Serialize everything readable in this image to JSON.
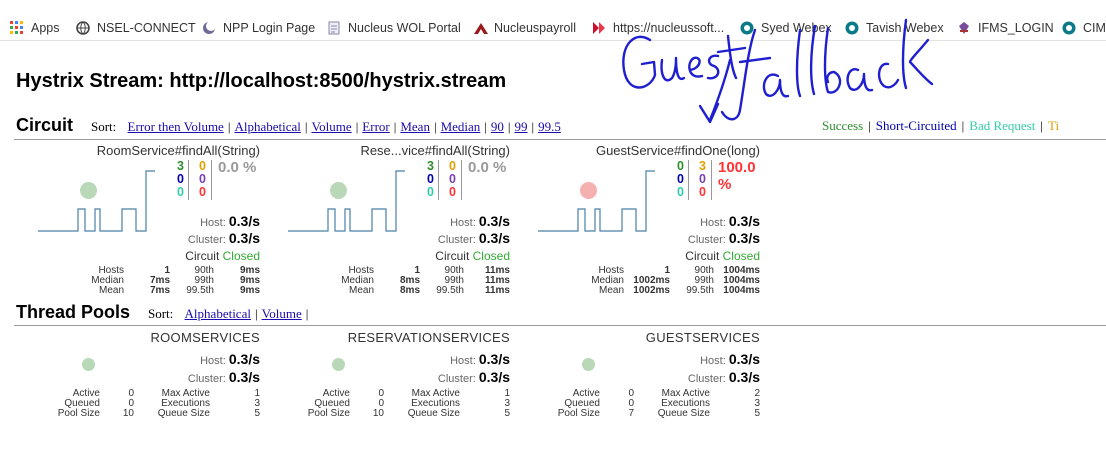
{
  "bookmarks": [
    {
      "label": "Apps",
      "icon": "apps-grid-icon"
    },
    {
      "label": "NSEL-CONNECT",
      "icon": "globe-icon"
    },
    {
      "label": "NPP Login Page",
      "icon": "moon-icon"
    },
    {
      "label": "Nucleus WOL Portal",
      "icon": "document-icon"
    },
    {
      "label": "Nucleuspayroll",
      "icon": "peak-logo-icon"
    },
    {
      "label": "https://nucleussoft...",
      "icon": "red-shape-icon"
    },
    {
      "label": "Syed Webex",
      "icon": "webex-icon"
    },
    {
      "label": "Tavish Webex",
      "icon": "webex-icon"
    },
    {
      "label": "IFMS_LOGIN",
      "icon": "emblem-icon"
    },
    {
      "label": "CIM",
      "icon": "webex-icon"
    }
  ],
  "page_title": "Hystrix Stream: http://localhost:8500/hystrix.stream",
  "circuit": {
    "heading": "Circuit",
    "sort_label": "Sort:",
    "sort_links": [
      "Error then Volume",
      "Alphabetical",
      "Volume",
      "Error",
      "Mean",
      "Median",
      "90",
      "99",
      "99.5"
    ],
    "legend": [
      {
        "label": "Success",
        "color": "#2f8f2f"
      },
      {
        "label": "Short-Circuited",
        "color": "#0000aa"
      },
      {
        "label": "Bad Request",
        "color": "#33ccaa"
      },
      {
        "label": "Ti",
        "color": "#e0a000"
      }
    ],
    "cards": [
      {
        "name": "RoomService#findAll(String)",
        "col1": [
          "3",
          "0",
          "0"
        ],
        "col2": [
          "0",
          "0",
          "0"
        ],
        "error_pct": "0.0 %",
        "error_color": "#999999",
        "host_label": "Host:",
        "host_rate": "0.3/s",
        "cluster_label": "Cluster:",
        "cluster_rate": "0.3/s",
        "circuit_label": "Circuit",
        "circuit_state": "Closed",
        "stats": {
          "hosts": "1",
          "median": "7ms",
          "mean": "7ms",
          "p90": "9ms",
          "p99": "9ms",
          "p995": "9ms"
        },
        "dot_color": "#b8d8b8"
      },
      {
        "name": "Rese...vice#findAll(String)",
        "col1": [
          "3",
          "0",
          "0"
        ],
        "col2": [
          "0",
          "0",
          "0"
        ],
        "error_pct": "0.0 %",
        "error_color": "#999999",
        "host_label": "Host:",
        "host_rate": "0.3/s",
        "cluster_label": "Cluster:",
        "cluster_rate": "0.3/s",
        "circuit_label": "Circuit",
        "circuit_state": "Closed",
        "stats": {
          "hosts": "1",
          "median": "8ms",
          "mean": "8ms",
          "p90": "11ms",
          "p99": "11ms",
          "p995": "11ms"
        },
        "dot_color": "#b8d8b8"
      },
      {
        "name": "GuestService#findOne(long)",
        "col1": [
          "0",
          "0",
          "0"
        ],
        "col2": [
          "3",
          "0",
          "0"
        ],
        "error_pct": "100.0 %",
        "error_color": "#ff3333",
        "host_label": "Host:",
        "host_rate": "0.3/s",
        "cluster_label": "Cluster:",
        "cluster_rate": "0.3/s",
        "circuit_label": "Circuit",
        "circuit_state": "Closed",
        "stats": {
          "hosts": "1",
          "median": "1002ms",
          "mean": "1002ms",
          "p90": "1004ms",
          "p99": "1004ms",
          "p995": "1004ms"
        },
        "dot_color": "#f5b0b0"
      }
    ],
    "stat_labels": {
      "hosts": "Hosts",
      "median": "Median",
      "mean": "Mean",
      "p90": "90th",
      "p99": "99th",
      "p995": "99.5th"
    }
  },
  "thread_pools": {
    "heading": "Thread Pools",
    "sort_label": "Sort:",
    "sort_links": [
      "Alphabetical",
      "Volume"
    ],
    "labels": {
      "active": "Active",
      "queued": "Queued",
      "pool_size": "Pool Size",
      "max_active": "Max Active",
      "executions": "Executions",
      "queue_size": "Queue Size"
    },
    "pools": [
      {
        "name": "ROOMSERVICES",
        "host_label": "Host:",
        "host_rate": "0.3/s",
        "cluster_label": "Cluster:",
        "cluster_rate": "0.3/s",
        "active": "0",
        "queued": "0",
        "pool_size": "10",
        "max_active": "1",
        "executions": "3",
        "queue_size": "5"
      },
      {
        "name": "RESERVATIONSERVICES",
        "host_label": "Host:",
        "host_rate": "0.3/s",
        "cluster_label": "Cluster:",
        "cluster_rate": "0.3/s",
        "active": "0",
        "queued": "0",
        "pool_size": "10",
        "max_active": "1",
        "executions": "3",
        "queue_size": "5"
      },
      {
        "name": "GUESTSERVICES",
        "host_label": "Host:",
        "host_rate": "0.3/s",
        "cluster_label": "Cluster:",
        "cluster_rate": "0.3/s",
        "active": "0",
        "queued": "0",
        "pool_size": "7",
        "max_active": "2",
        "executions": "3",
        "queue_size": "5"
      }
    ]
  },
  "annotation": "Guest ↓ fallback",
  "colors": {
    "link": "#1a0dab",
    "success": "#2f8f2f",
    "short_circuited": "#0000aa",
    "bad_request": "#33ccaa",
    "timeout": "#e0a000",
    "failure": "#ff3333",
    "closed": "#33aa33",
    "ink": "#1f1fd0"
  }
}
